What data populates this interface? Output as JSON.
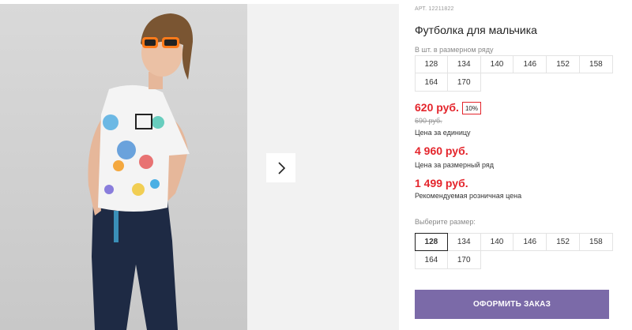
{
  "product": {
    "sku": "АРТ. 12211822",
    "title": "Футболка для мальчика"
  },
  "series": {
    "caption": "В шт. в размерном ряду",
    "sizes": [
      "128",
      "134",
      "140",
      "146",
      "152",
      "158",
      "164",
      "170"
    ]
  },
  "pricing": {
    "price": "620 руб.",
    "discount": "10%",
    "old_price": "690 руб.",
    "unit_caption": "Цена за единицу",
    "row_price": "4 960 руб.",
    "row_caption": "Цена за размерный ряд",
    "rrp": "1 499 руб.",
    "rrp_caption": "Рекомендуемая розничная цена",
    "price_color": "#e4252c"
  },
  "size_select": {
    "caption": "Выберите размер:",
    "selected": "128",
    "sizes": [
      "128",
      "134",
      "140",
      "146",
      "152",
      "158",
      "164",
      "170"
    ]
  },
  "order": {
    "label": "ОФОРМИТЬ ЗАКАЗ",
    "color": "#7b6aa8"
  },
  "gallery": {
    "next_icon": "chevron-right-icon",
    "image_subject": "boy in white paint-splatter t-shirt and orange sunglasses"
  }
}
